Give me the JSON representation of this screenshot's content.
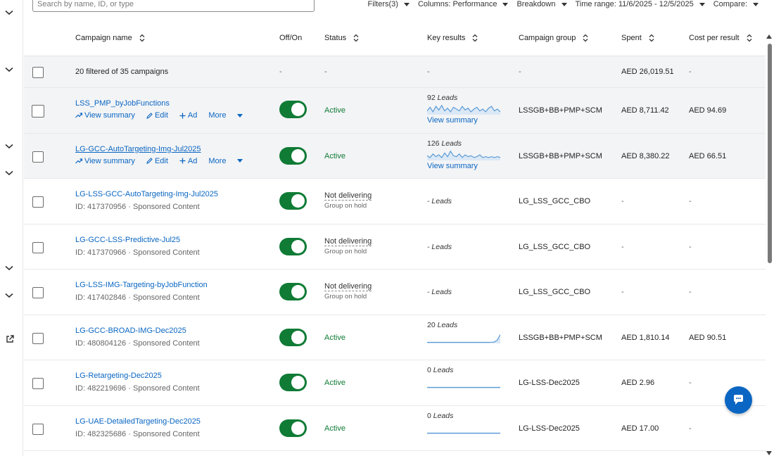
{
  "search": {
    "placeholder": "Search by name, ID, or type"
  },
  "toolbar": {
    "filters": "Filters(3)",
    "columns_label": "Columns:",
    "columns_value": "Performance",
    "breakdown": "Breakdown",
    "time_range_label": "Time range:",
    "time_range_value": "11/6/2025 - 12/5/2025",
    "compare": "Compare:"
  },
  "columns": {
    "name": "Campaign name",
    "onoff": "Off/On",
    "status": "Status",
    "key_results": "Key results",
    "group": "Campaign group",
    "spent": "Spent",
    "cpr": "Cost per result"
  },
  "summary": {
    "label": "20 filtered of 35 campaigns",
    "onoff": "-",
    "status": "-",
    "key_results": "-",
    "group": "-",
    "spent": "AED 26,019.51",
    "cpr": "-"
  },
  "actions": {
    "view_summary": "View summary",
    "edit": "Edit",
    "ad": "Ad",
    "more": "More"
  },
  "rows": [
    {
      "name": "LSS_PMP_byJobFunctions",
      "sub": "",
      "status": "Active",
      "status_sub": "",
      "kr_count": "92",
      "kr_unit": "Leads",
      "kr_link": "View summary",
      "group": "LSSGB+BB+PMP+SCM",
      "spent": "AED 8,711.42",
      "cpr": "AED 94.69",
      "spark": [
        0.3,
        0.7,
        0.2,
        0.8,
        0.4,
        0.9,
        0.3,
        0.6,
        0.2,
        0.7,
        0.5,
        0.3,
        0.8,
        0.4,
        0.6,
        0.2,
        0.5,
        0.7,
        0.3,
        0.5,
        0.2,
        0.6,
        0.8,
        0.3,
        0.5,
        0.2
      ]
    },
    {
      "name": "LG-GCC-AutoTargeting-Img-Jul2025",
      "sub": "",
      "status": "Active",
      "status_sub": "",
      "kr_count": "126",
      "kr_unit": "Leads",
      "kr_link": "View summary",
      "group": "LSSGB+BB+PMP+SCM",
      "spent": "AED 8,380.22",
      "cpr": "AED 66.51",
      "spark": [
        0.4,
        0.2,
        0.6,
        0.3,
        0.5,
        0.2,
        0.7,
        0.3,
        0.9,
        0.4,
        0.3,
        0.6,
        0.2,
        0.5,
        0.3,
        0.4,
        0.2,
        0.3,
        0.5,
        0.2,
        0.3,
        0.2,
        0.3,
        0.2,
        0.3,
        0.2
      ]
    },
    {
      "name": "LG-LSS-GCC-AutoTargeting-Img-Jul2025",
      "sub": "ID: 417370956 · Sponsored Content",
      "status": "Not delivering",
      "status_sub": "Group on hold",
      "kr_count": "-",
      "kr_unit": "Leads",
      "kr_link": "",
      "group": "LG_LSS_GCC_CBO",
      "spent": "-",
      "cpr": "-",
      "spark": []
    },
    {
      "name": "LG-GCC-LSS-Predictive-Jul25",
      "sub": "ID: 417370966 · Sponsored Content",
      "status": "Not delivering",
      "status_sub": "Group on hold",
      "kr_count": "-",
      "kr_unit": "Leads",
      "kr_link": "",
      "group": "LG_LSS_GCC_CBO",
      "spent": "-",
      "cpr": "-",
      "spark": []
    },
    {
      "name": "LG-LSS-IMG-Targeting-byJobFunction",
      "sub": "ID: 417402846 · Sponsored Content",
      "status": "Not delivering",
      "status_sub": "Group on hold",
      "kr_count": "-",
      "kr_unit": "Leads",
      "kr_link": "",
      "group": "LG_LSS_GCC_CBO",
      "spent": "-",
      "cpr": "-",
      "spark": []
    },
    {
      "name": "LG-GCC-BROAD-IMG-Dec2025",
      "sub": "ID: 480804126 · Sponsored Content",
      "status": "Active",
      "status_sub": "",
      "kr_count": "20",
      "kr_unit": "Leads",
      "kr_link": "",
      "group": "LSSGB+BB+PMP+SCM",
      "spent": "AED 1,810.14",
      "cpr": "AED 90.51",
      "spark": [
        0,
        0,
        0,
        0,
        0,
        0,
        0,
        0,
        0,
        0,
        0,
        0,
        0,
        0,
        0,
        0,
        0,
        0,
        0,
        0,
        0,
        0,
        0.02,
        0.05,
        0.3,
        1
      ]
    },
    {
      "name": "LG-Retargeting-Dec2025",
      "sub": "ID: 482219696 · Sponsored Content",
      "status": "Active",
      "status_sub": "",
      "kr_count": "0",
      "kr_unit": "Leads",
      "kr_link": "",
      "group": "LG-LSS-Dec2025",
      "spent": "AED 2.96",
      "cpr": "-",
      "spark": [
        0,
        0,
        0,
        0,
        0,
        0,
        0,
        0,
        0,
        0,
        0,
        0,
        0,
        0,
        0,
        0,
        0,
        0,
        0,
        0,
        0,
        0,
        0,
        0,
        0,
        0
      ]
    },
    {
      "name": "LG-UAE-DetailedTargeting-Dec2025",
      "sub": "ID: 482325686 · Sponsored Content",
      "status": "Active",
      "status_sub": "",
      "kr_count": "0",
      "kr_unit": "Leads",
      "kr_link": "",
      "group": "LG-LSS-Dec2025",
      "spent": "AED 17.00",
      "cpr": "-",
      "spark": [
        0,
        0,
        0,
        0,
        0,
        0,
        0,
        0,
        0,
        0,
        0,
        0,
        0,
        0,
        0,
        0,
        0,
        0,
        0,
        0,
        0,
        0,
        0,
        0,
        0,
        0
      ]
    }
  ],
  "icons": {
    "rail": [
      "chevron-down-icon",
      "external-link-icon"
    ],
    "chat": "chat-icon"
  },
  "colors": {
    "link": "#0a66c2",
    "active": "#0f7b35",
    "toggle_on": "#0f7b35",
    "spark": "#5b9bd5"
  }
}
